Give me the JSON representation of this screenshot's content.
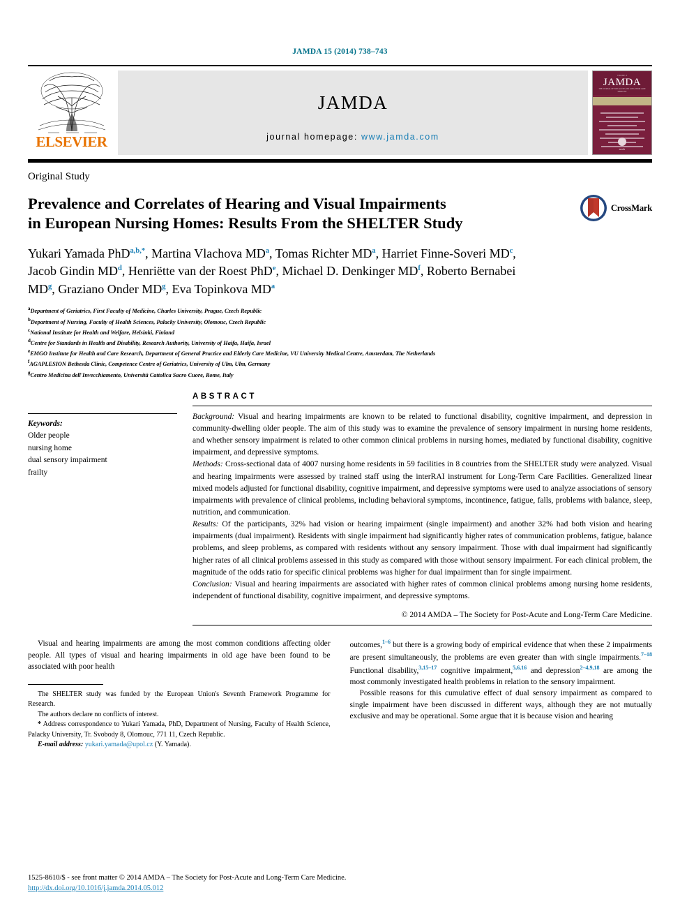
{
  "running_head": "JAMDA 15 (2014) 738–743",
  "masthead": {
    "publisher": "ELSEVIER",
    "journal_title": "JAMDA",
    "homepage_label": "journal homepage:",
    "homepage_url": "www.jamda.com",
    "cover": {
      "title": "JAMDA",
      "subtitle": "THE JOURNAL OF POST-ACUTE AND LONG-TERM CARE MEDICINE",
      "eyebrow": "VOLUME 15",
      "footer_label": "amda",
      "footer_sub": "THE SOCIETY FOR POST-ACUTE AND LONG-TERM CARE MEDICINE"
    }
  },
  "crossmark": {
    "label": "CrossMark",
    "circle_color": "#24477f",
    "ribbon_color": "#c0392b"
  },
  "article": {
    "section_type": "Original Study",
    "title_line1": "Prevalence and Correlates of Hearing and Visual Impairments",
    "title_line2": "in European Nursing Homes: Results From the SHELTER Study",
    "authors": [
      {
        "name": "Yukari Yamada PhD",
        "marks": "a,b,*",
        "sep": ", "
      },
      {
        "name": "Martina Vlachova MD",
        "marks": "a",
        "sep": ", "
      },
      {
        "name": "Tomas Richter MD",
        "marks": "a",
        "sep": ", "
      },
      {
        "name": "Harriet Finne-Soveri MD",
        "marks": "c",
        "sep": ", "
      },
      {
        "name": "Jacob Gindin MD",
        "marks": "d",
        "sep": ", "
      },
      {
        "name": "Henriëtte van der Roest PhD",
        "marks": "e",
        "sep": ", "
      },
      {
        "name": "Michael D. Denkinger MD",
        "marks": "f",
        "sep": ", "
      },
      {
        "name": "Roberto Bernabei MD",
        "marks": "g",
        "sep": ", "
      },
      {
        "name": "Graziano Onder MD",
        "marks": "g",
        "sep": ", "
      },
      {
        "name": "Eva Topinkova MD",
        "marks": "a",
        "sep": ""
      }
    ],
    "affiliations": [
      {
        "mark": "a",
        "text": "Department of Geriatrics, First Faculty of Medicine, Charles University, Prague, Czech Republic"
      },
      {
        "mark": "b",
        "text": "Department of Nursing, Faculty of Health Sciences, Palacky University, Olomouc, Czech Republic"
      },
      {
        "mark": "c",
        "text": "National Institute for Health and Welfare, Helsinki, Finland"
      },
      {
        "mark": "d",
        "text": "Centre for Standards in Health and Disability, Research Authority, University of Haifa, Haifa, Israel"
      },
      {
        "mark": "e",
        "text": "EMGO Institute for Health and Care Research, Department of General Practice and Elderly Care Medicine, VU University Medical Centre, Amsterdam, The Netherlands"
      },
      {
        "mark": "f",
        "text": "AGAPLESION Bethesda Clinic, Competence Centre of Geriatrics, University of Ulm, Ulm, Germany"
      },
      {
        "mark": "g",
        "text": "Centro Medicina dell'Invecchiamento, Università Cattolica Sacro Cuore, Rome, Italy"
      }
    ]
  },
  "keywords": {
    "heading": "Keywords:",
    "items": [
      "Older people",
      "nursing home",
      "dual sensory impairment",
      "frailty"
    ]
  },
  "abstract": {
    "heading": "ABSTRACT",
    "background_label": "Background:",
    "background": " Visual and hearing impairments are known to be related to functional disability, cognitive impairment, and depression in community-dwelling older people. The aim of this study was to examine the prevalence of sensory impairment in nursing home residents, and whether sensory impairment is related to other common clinical problems in nursing homes, mediated by functional disability, cognitive impairment, and depressive symptoms.",
    "methods_label": "Methods:",
    "methods": " Cross-sectional data of 4007 nursing home residents in 59 facilities in 8 countries from the SHELTER study were analyzed. Visual and hearing impairments were assessed by trained staff using the interRAI instrument for Long-Term Care Facilities. Generalized linear mixed models adjusted for functional disability, cognitive impairment, and depressive symptoms were used to analyze associations of sensory impairments with prevalence of clinical problems, including behavioral symptoms, incontinence, fatigue, falls, problems with balance, sleep, nutrition, and communication.",
    "results_label": "Results:",
    "results": " Of the participants, 32% had vision or hearing impairment (single impairment) and another 32% had both vision and hearing impairments (dual impairment). Residents with single impairment had significantly higher rates of communication problems, fatigue, balance problems, and sleep problems, as compared with residents without any sensory impairment. Those with dual impairment had significantly higher rates of all clinical problems assessed in this study as compared with those without sensory impairment. For each clinical problem, the magnitude of the odds ratio for specific clinical problems was higher for dual impairment than for single impairment.",
    "conclusion_label": "Conclusion:",
    "conclusion": " Visual and hearing impairments are associated with higher rates of common clinical problems among nursing home residents, independent of functional disability, cognitive impairment, and depressive symptoms.",
    "copyright": "© 2014 AMDA – The Society for Post-Acute and Long-Term Care Medicine."
  },
  "body": {
    "left_para1": "Visual and hearing impairments are among the most common conditions affecting older people. All types of visual and hearing impairments in old age have been found to be associated with poor health",
    "right_para1_a": "outcomes,",
    "right_cite1": "1–6",
    "right_para1_b": " but there is a growing body of empirical evidence that when these 2 impairments are present simultaneously, the problems are even greater than with single impairments.",
    "right_cite2": "7–18",
    "right_para1_c": " Functional disability,",
    "right_cite3": "3,15–17",
    "right_para1_d": " cognitive impairment,",
    "right_cite4": "5,6,16",
    "right_para1_e": " and depression",
    "right_cite5": "2–4,9,18",
    "right_para1_f": " are among the most commonly investigated health problems in relation to the sensory impairment.",
    "right_para2": "Possible reasons for this cumulative effect of dual sensory impairment as compared to single impairment have been discussed in different ways, although they are not mutually exclusive and may be operational. Some argue that it is because vision and hearing"
  },
  "footnotes": {
    "funding": "The SHELTER study was funded by the European Union's Seventh Framework Programme for Research.",
    "conflicts": "The authors declare no conflicts of interest.",
    "star_mark": "*",
    "correspondence": " Address correspondence to Yukari Yamada, PhD, Department of Nursing, Faculty of Health Science, Palacky University, Tr. Svobody 8, Olomouc, 771 11, Czech Republic.",
    "email_label": "E-mail address:",
    "email": "yukari.yamada@upol.cz",
    "email_suffix": " (Y. Yamada)."
  },
  "footer": {
    "issn_line": "1525-8610/$ - see front matter © 2014 AMDA – The Society for Post-Acute and Long-Term Care Medicine.",
    "doi": "http://dx.doi.org/10.1016/j.jamda.2014.05.012"
  }
}
